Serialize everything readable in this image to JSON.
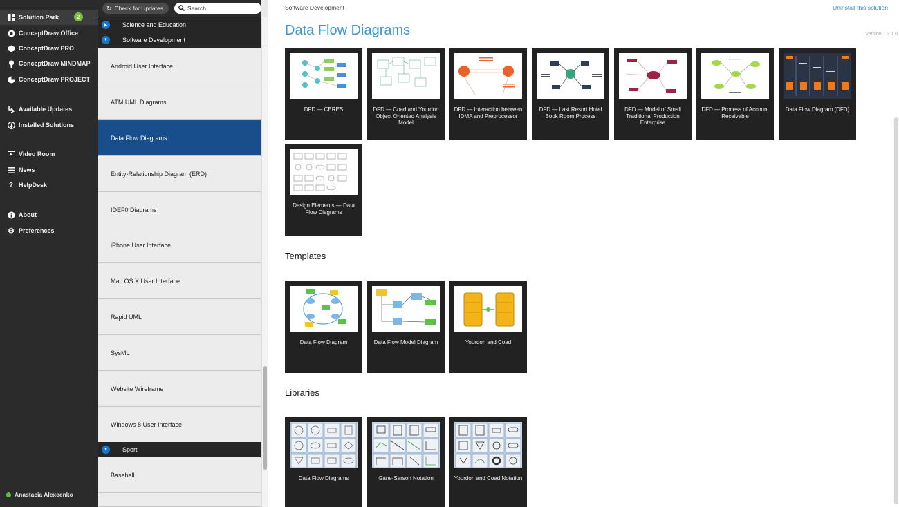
{
  "nav": {
    "items": [
      {
        "label": "Solution Park",
        "icon": "grid-icon",
        "badge": "2"
      },
      {
        "label": "ConceptDraw Office",
        "icon": "office-icon"
      },
      {
        "label": "ConceptDraw PRO",
        "icon": "pro-icon"
      },
      {
        "label": "ConceptDraw MINDMAP",
        "icon": "mindmap-icon"
      },
      {
        "label": "ConceptDraw PROJECT",
        "icon": "project-icon"
      },
      {
        "label": "Available Updates",
        "icon": "updates-icon"
      },
      {
        "label": "Installed Solutions",
        "icon": "download-icon"
      },
      {
        "label": "Video Room",
        "icon": "video-icon"
      },
      {
        "label": "News",
        "icon": "news-icon"
      },
      {
        "label": "HelpDesk",
        "icon": "help-icon"
      },
      {
        "label": "About",
        "icon": "info-icon"
      },
      {
        "label": "Preferences",
        "icon": "gear-icon"
      }
    ],
    "user": "Anastacia Alexeenko"
  },
  "list": {
    "check_updates": "Check for Updates",
    "search_placeholder": "Search",
    "categories": [
      "Science and Education",
      "Software Development",
      "Sport"
    ],
    "solutions": [
      "Android User Interface",
      "ATM UML Diagrams",
      "Data Flow Diagrams",
      "Entity-Relationship Diagram (ERD)",
      "IDEF0 Diagrams",
      "iPhone User Interface",
      "Mac OS X User Interface",
      "Rapid UML",
      "SysML",
      "Website Wireframe",
      "Windows 8 User Interface",
      "Baseball"
    ],
    "selected": "Data Flow Diagrams"
  },
  "main": {
    "breadcrumb": "Software Development",
    "uninstall": "Uninstall this solution",
    "title": "Data Flow Diagrams",
    "version": "Version 1.2.1.0",
    "examples": [
      "DFD — CERES",
      "DFD — Coad and Yourdon Object Oriented Analysis Model",
      "DFD — Interaction between IDMA and Preprocessor",
      "DFD — Last Resort Hotel Book Room Process",
      "DFD — Model of Small Traditional Production Enterprise",
      "DFD — Process of Account Receivable",
      "Data Flow Diagram (DFD)",
      "Design Elements — Data Flow Diagrams"
    ],
    "templates_title": "Templates",
    "templates": [
      "Data Flow Diagram",
      "Data Flow Model Diagram",
      "Yourdon and Coad"
    ],
    "libraries_title": "Libraries",
    "libraries": [
      "Data Flow Diagrams",
      "Gane-Sarson Notation",
      "Yourdon and Coad Notation"
    ]
  },
  "colors": {
    "accent": "#3d94d8",
    "selected": "#184e8c",
    "badge": "#7cc242"
  }
}
